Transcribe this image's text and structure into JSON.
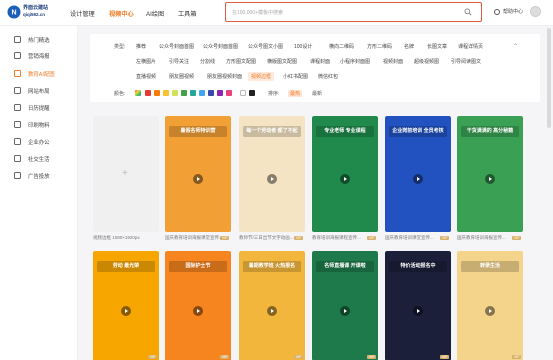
{
  "brand": {
    "name": "界面云建站",
    "domain": "qiqi592.cn"
  },
  "nav": [
    {
      "label": "设计管理"
    },
    {
      "label": "视频中心",
      "active": true
    },
    {
      "label": "AI绘图"
    },
    {
      "label": "工具箱"
    }
  ],
  "search": {
    "placeholder": "在100,000+模板中搜索"
  },
  "header_right": {
    "help_label": "帮助中心"
  },
  "sidebar": [
    {
      "label": "热门精选",
      "icon": "home-icon"
    },
    {
      "label": "营销海报",
      "icon": "poster-icon"
    },
    {
      "label": "教育AI配图",
      "icon": "image-icon",
      "active": true
    },
    {
      "label": "网站布局",
      "icon": "layout-icon"
    },
    {
      "label": "日历提醒",
      "icon": "calendar-icon"
    },
    {
      "label": "印刷物料",
      "icon": "print-icon"
    },
    {
      "label": "企业办公",
      "icon": "office-icon"
    },
    {
      "label": "社交生活",
      "icon": "social-icon"
    },
    {
      "label": "广告投放",
      "icon": "ad-icon"
    }
  ],
  "filters": {
    "type_label": "类型:",
    "type_rows": [
      [
        "推荐",
        "公众号封面首图",
        "公众号封面首图",
        "公众号图文小图",
        "100设计",
        "横向二维码",
        "方形二维码",
        "名牌",
        "长图文章",
        "课程详情页"
      ],
      [
        "左横图片",
        "引导关注",
        "分割线",
        "方形图文配图",
        "横版图文配图",
        "课程封面",
        "小程序封面图",
        "视频封面",
        "超级视频图",
        "引导阅读图文"
      ],
      [
        "直播视频",
        "朋友圈视频",
        "朋友圈视频封面",
        "视频边框",
        "小红书配图",
        "微信红包"
      ]
    ],
    "active_type": "视频边框",
    "color_label": "颜色:",
    "colors": [
      "#e53935",
      "#f57c00",
      "#fbc02d",
      "#d4e157",
      "#43a047",
      "#26a69a",
      "#42a5f5",
      "#3949ab",
      "#8e24aa",
      "#ec407a",
      "#ffffff",
      "#212121"
    ],
    "sort_label": "排序:",
    "sort_options": [
      {
        "label": "最热",
        "active": true
      },
      {
        "label": "最新"
      }
    ]
  },
  "cards_row1": [
    {
      "caption": "视频边框 1080×1920px",
      "banner": "",
      "color": "#ffffff",
      "placeholder": true
    },
    {
      "caption": "国庆教育培训海报课堂宣传...",
      "banner": "暑假名师特训营",
      "color": "#f2a036"
    },
    {
      "caption": "教师节/三日出节文字动画...",
      "banner": "每一个劳动者 都了不起",
      "color": "#f5e4c3"
    },
    {
      "caption": "教育培训海报课程宣传...",
      "banner": "专业老师 专业课程",
      "color": "#1f8a4c"
    },
    {
      "caption": "国庆教育培训课堂宣传...",
      "banner": "企业岗前培训 全员考核",
      "color": "#2252c0"
    },
    {
      "caption": "国庆教育培训海报宣传...",
      "banner": "干货满满的 高分秘籍",
      "color": "#3aa054"
    }
  ],
  "cards_row2": [
    {
      "banner": "劳动 最光荣",
      "color": "#f7a600"
    },
    {
      "banner": "国际护士节",
      "color": "#f6841f"
    },
    {
      "banner": "暑期教学班 火热报名",
      "color": "#f3b63c"
    },
    {
      "banner": "名师直播课 开课啦",
      "color": "#1e7a4a"
    },
    {
      "banner": "特价活动报名中",
      "color": "#1b1f3a"
    },
    {
      "banner": "转录生活",
      "color": "#f3d48a"
    }
  ]
}
